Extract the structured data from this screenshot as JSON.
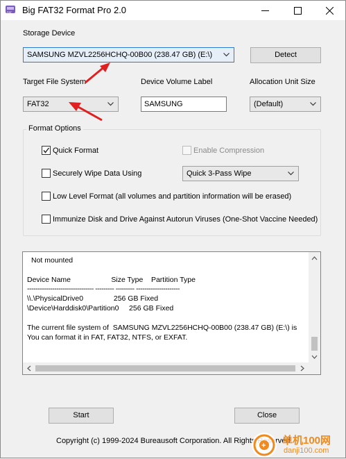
{
  "window": {
    "title": "Big FAT32 Format Pro 2.0"
  },
  "storage": {
    "label": "Storage Device",
    "selected": "SAMSUNG MZVL2256HCHQ-00B00 (238.47 GB) (E:\\)",
    "detect_label": "Detect"
  },
  "fields": {
    "target_fs_label": "Target File System",
    "target_fs_value": "FAT32",
    "volume_label_label": "Device Volume Label",
    "volume_label_value": "SAMSUNG",
    "alloc_label": "Allocation Unit Size",
    "alloc_value": "(Default)"
  },
  "format_options": {
    "title": "Format Options",
    "quick_format": {
      "label": "Quick Format",
      "checked": true
    },
    "enable_compression": {
      "label": "Enable Compression",
      "checked": false,
      "disabled": true
    },
    "secure_wipe": {
      "label": "Securely Wipe Data Using",
      "checked": false
    },
    "wipe_method": "Quick 3-Pass Wipe",
    "low_level": {
      "label": "Low Level Format (all volumes and partition information will be erased)",
      "checked": false
    },
    "immunize": {
      "label": "Immunize Disk and Drive Against Autorun Viruses (One-Shot Vaccine Needed)",
      "checked": false
    }
  },
  "log": {
    "line1": "Not mounted",
    "line2": "Device Name                    Size Type    Partition Type",
    "line3": "-------------------------------- --------- --------- ---------------------",
    "line4": "\\\\.\\PhysicalDrive0               256 GB Fixed",
    "line5": "\\Device\\Harddisk0\\Partition0     256 GB Fixed",
    "line6": "The current file system of  SAMSUNG MZVL2256HCHQ-00B00 (238.47 GB) (E:\\) is",
    "line7": "You can format it in FAT, FAT32, NTFS, or EXFAT."
  },
  "actions": {
    "start_label": "Start",
    "close_label": "Close"
  },
  "footer": {
    "copyright": "Copyright (c) 1999-2024 Bureausoft Corporation. All Rights Reserved."
  },
  "watermark": {
    "text1": "单机100网",
    "text2": "danji100.com"
  },
  "colors": {
    "accent": "#2a7ad2",
    "arrow": "#e02020"
  }
}
